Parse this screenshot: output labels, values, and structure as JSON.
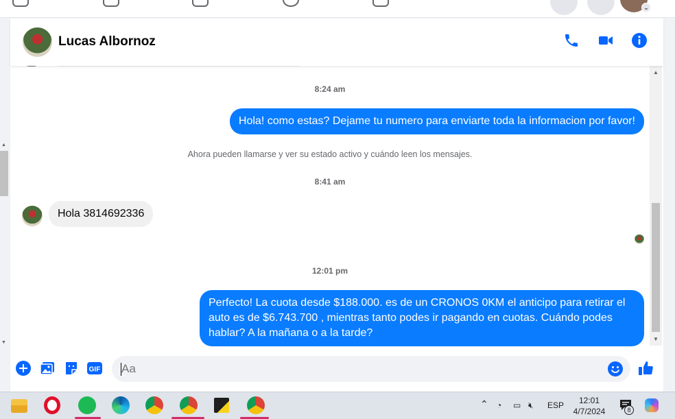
{
  "header": {
    "contact_name": "Lucas Albornoz"
  },
  "messages": {
    "ts1": "8:24 am",
    "out1": "Hola! como estas? Dejame tu numero para enviarte toda la informacion por favor!",
    "system": "Ahora pueden llamarse y ver su estado activo y cuándo leen los mensajes.",
    "ts2": "8:41 am",
    "in1": "Hola 3814692336",
    "ts3": "12:01 pm",
    "out2": "Perfecto! La cuota desde $188.000. es de un CRONOS 0KM el anticipo para retirar el auto es de $6.743.700 , mientras tanto podes ir pagando en cuotas. Cuándo podes hablar? A la mañana o a la tarde?"
  },
  "composer": {
    "value": "",
    "placeholder": "Aa",
    "gif_label": "GIF"
  },
  "taskbar": {
    "lang": "ESP",
    "time": "12:01",
    "date": "4/7/2024",
    "notif_count": "8"
  },
  "colors": {
    "accent": "#0a7cff",
    "icon_blue": "#0866ff"
  }
}
